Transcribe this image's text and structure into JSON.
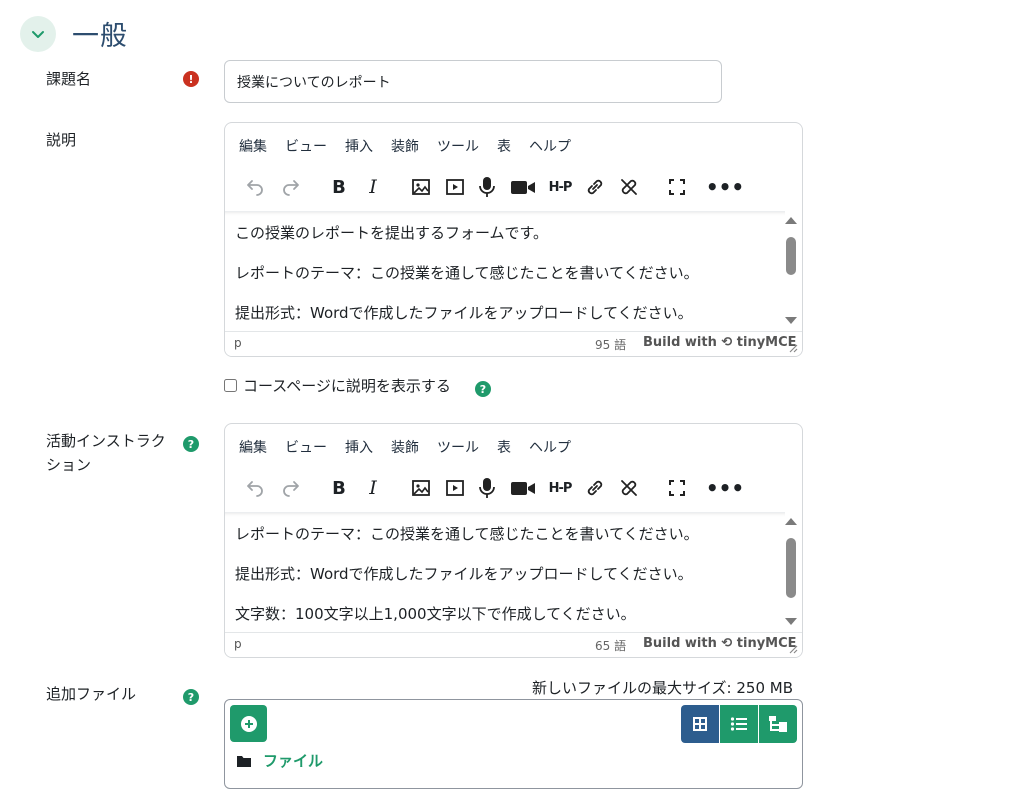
{
  "section": {
    "title": "一般"
  },
  "assignment_name": {
    "label": "課題名",
    "value": "授業についてのレポート"
  },
  "description": {
    "label": "説明",
    "menu": [
      "編集",
      "ビュー",
      "挿入",
      "装飾",
      "ツール",
      "表",
      "ヘルプ"
    ],
    "paragraphs": [
      "この授業のレポートを提出するフォームです。",
      "レポートのテーマ：この授業を通して感じたことを書いてください。",
      "提出形式：Wordで作成したファイルをアップロードしてください。"
    ],
    "path": "p",
    "word_count": "95 語",
    "brand": "Build with ⟲ tinyMCE"
  },
  "show_description": {
    "label": "コースページに説明を表示する",
    "checked": false
  },
  "activity_instructions": {
    "label_line1": "活動インストラク",
    "label_line2": "ション",
    "menu": [
      "編集",
      "ビュー",
      "挿入",
      "装飾",
      "ツール",
      "表",
      "ヘルプ"
    ],
    "paragraphs": [
      "レポートのテーマ：この授業を通して感じたことを書いてください。",
      "提出形式：Wordで作成したファイルをアップロードしてください。",
      "文字数：100文字以上1,000文字以下で作成してください。"
    ],
    "path": "p",
    "word_count": "65 語",
    "brand": "Build with ⟲ tinyMCE"
  },
  "additional_files": {
    "label": "追加ファイル",
    "max_size": "新しいファイルの最大サイズ: 250 MB",
    "folder_name": "ファイル"
  },
  "colors": {
    "accent": "#1f9a6b",
    "title": "#2d4d6f",
    "required": "#ca3120",
    "active_view": "#2d5d8e"
  }
}
